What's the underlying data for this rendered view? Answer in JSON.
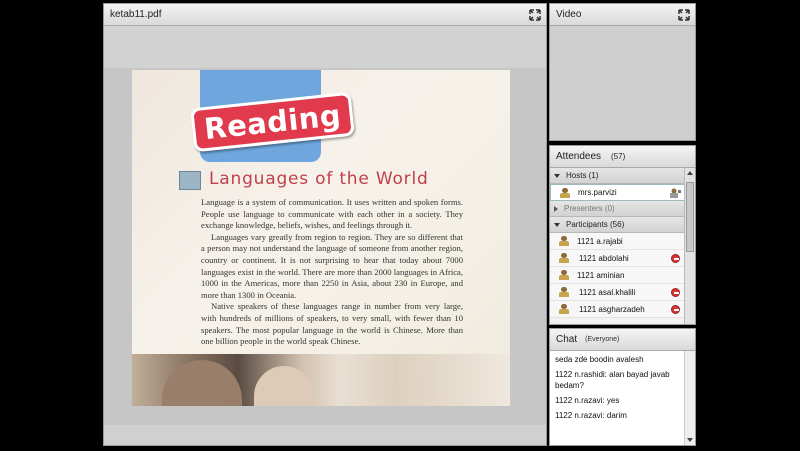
{
  "share_pod": {
    "title": "ketab11.pdf",
    "document": {
      "banner": "Reading",
      "heading": "Languages of the World",
      "paragraphs": [
        "Language is a system of communication. It uses written and spoken forms. People use language to communicate with each other in a society. They exchange knowledge, beliefs, wishes, and feelings through it.",
        "Languages vary greatly from region to region. They are so different that a person may not understand the language of someone from another region, country or continent. It is not surprising to hear that today about 7000 languages exist in the world. There are more than 2000 languages in Africa, 1000 in the Americas, more than 2250 in Asia, about 230 in Europe, and more than 1300 in Oceania.",
        "Native speakers of these languages range in number from very large, with hundreds of millions of speakers, to very small, with fewer than 10 speakers. The most popular language in the world is Chinese. More than one billion people in the world speak Chinese."
      ]
    }
  },
  "video_pod": {
    "title": "Video"
  },
  "attendees_pod": {
    "title": "Attendees",
    "count": "(57)",
    "groups": {
      "hosts": {
        "label": "Hosts (1)",
        "members": [
          "mrs.parvizi"
        ]
      },
      "presenters": {
        "label": "Presenters (0)"
      },
      "participants": {
        "label": "Participants (56)",
        "members": [
          "1121 a.rajabi",
          "1121 abdolahi",
          "1121 aminian",
          "1121 asal.khalili",
          "1121 asgharzadeh"
        ]
      }
    }
  },
  "chat_pod": {
    "title": "Chat",
    "scope": "(Everyone)",
    "messages": [
      "seda zde boodin avalesh",
      "1122 n.rashidi: alan bayad javab bedam?",
      "1122 n.razavi: yes",
      "1122 n.razavi: darim"
    ]
  },
  "colors": {
    "banner": "#e03a4c",
    "tab": "#6ea6dd",
    "heading": "#c0404a"
  }
}
